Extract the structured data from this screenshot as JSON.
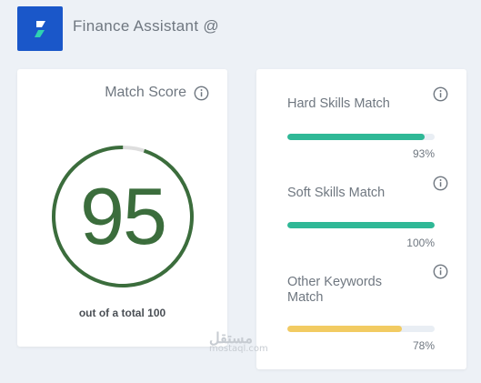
{
  "app": {
    "title": "Finance Assistant @",
    "accent": "#1a57c9"
  },
  "match_score": {
    "title": "Match Score",
    "score": "95",
    "score_value": 95,
    "caption": "out of a total 100",
    "ring_color": "#3b6d3c"
  },
  "skills": [
    {
      "label": "Hard Skills Match",
      "percent_text": "93%",
      "value": 93,
      "color": "#2fb896"
    },
    {
      "label": "Soft Skills Match",
      "percent_text": "100%",
      "value": 100,
      "color": "#2fb896"
    },
    {
      "label": "Other Keywords Match",
      "percent_text": "78%",
      "value": 78,
      "color": "#f2cb62"
    }
  ],
  "watermark": {
    "arabic": "مستقل",
    "latin": "mostaql.com"
  }
}
